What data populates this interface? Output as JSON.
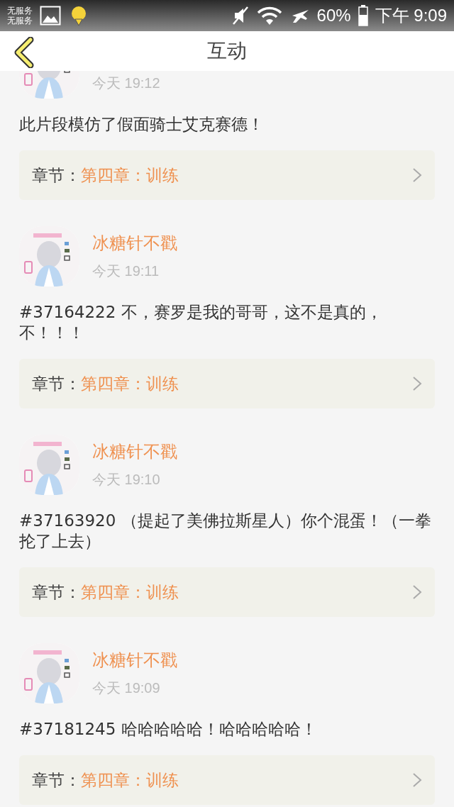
{
  "status_bar": {
    "carrier_lines": [
      "无服务",
      "无服务"
    ],
    "battery": "60%",
    "time": "下午 9:09"
  },
  "header": {
    "title": "互动"
  },
  "posts": [
    {
      "time": "今天 19:12",
      "text": "此片段模仿了假面骑士艾克赛德！",
      "chapter_label": "章节：",
      "chapter": "第四章：训练"
    },
    {
      "name": "冰糖针不戳",
      "time": "今天 19:11",
      "text": "#37164222 不，赛罗是我的哥哥，这不是真的，不！！！",
      "chapter_label": "章节：",
      "chapter": "第四章：训练"
    },
    {
      "name": "冰糖针不戳",
      "time": "今天 19:10",
      "text": "#37163920 （提起了美佛拉斯星人）你个混蛋！（一拳抡了上去）",
      "chapter_label": "章节：",
      "chapter": "第四章：训练"
    },
    {
      "name": "冰糖针不戳",
      "time": "今天 19:09",
      "text": "#37181245 哈哈哈哈哈！哈哈哈哈哈！",
      "chapter_label": "章节：",
      "chapter": "第四章：训练"
    }
  ]
}
